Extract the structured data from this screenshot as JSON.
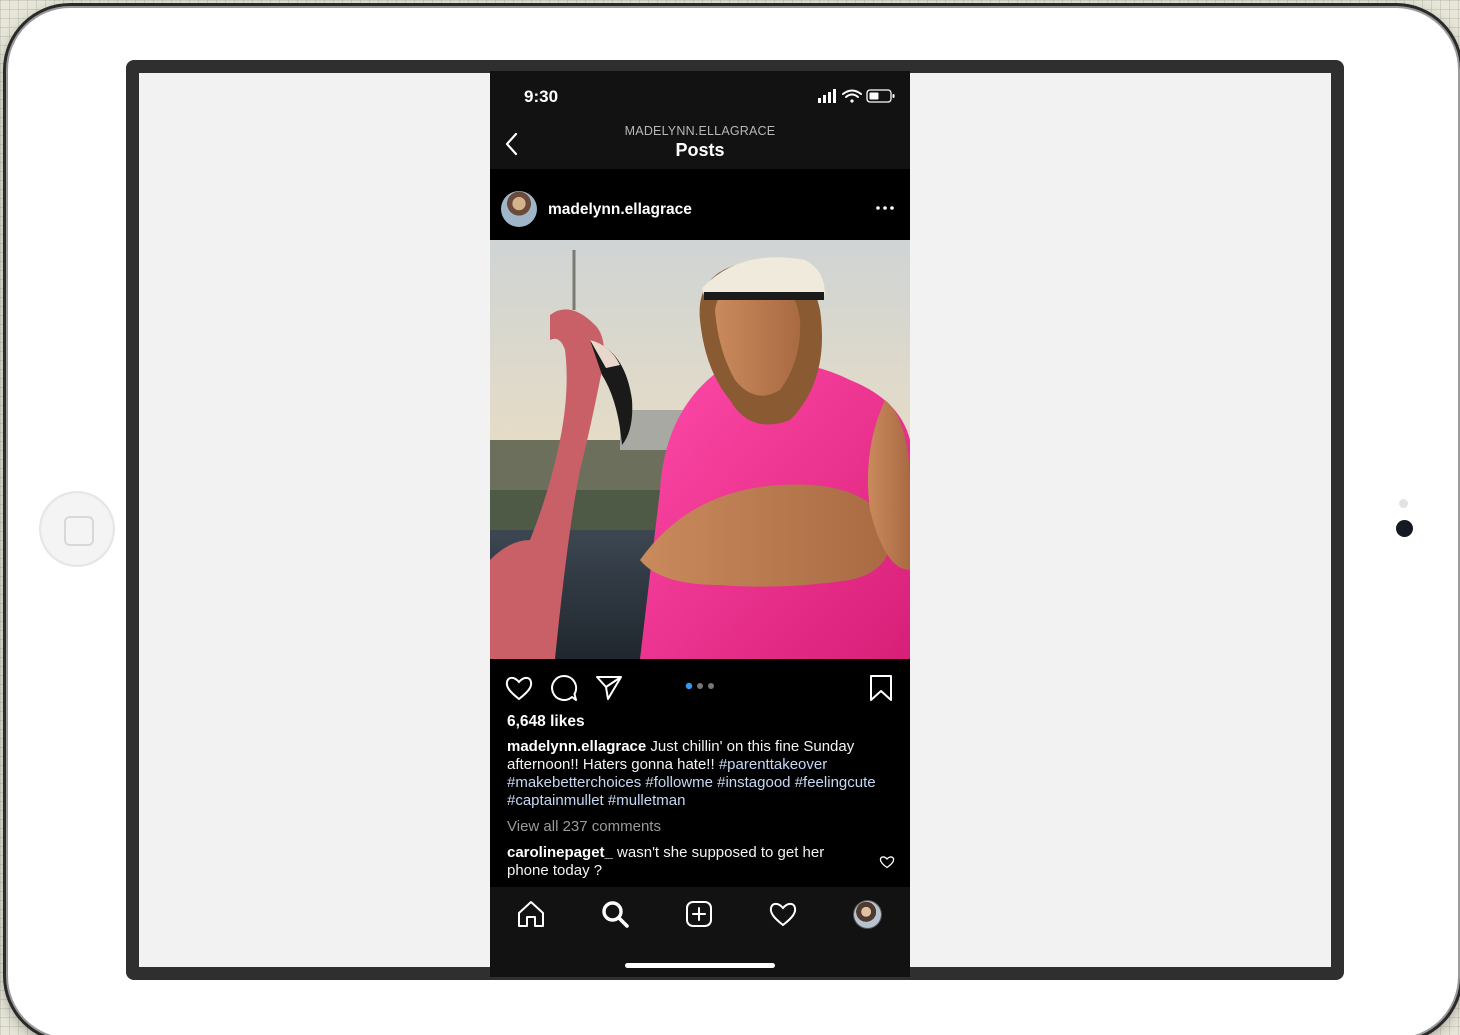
{
  "status_bar": {
    "time": "9:30"
  },
  "nav": {
    "subtitle": "MADELYNN.ELLAGRACE",
    "title": "Posts"
  },
  "post": {
    "username": "madelynn.ellagrace",
    "likes": "6,648 likes",
    "carousel": {
      "count": 3,
      "active": 1,
      "active_color": "#3897f0"
    },
    "caption": {
      "username": "madelynn.ellagrace",
      "text": "Just chillin' on this fine Sunday afternoon!! Haters gonna hate!!",
      "hashtags": [
        "#parenttakeover",
        "#makebetterchoices",
        "#followme",
        "#instagood",
        "#feelingcute",
        "#captainmullet",
        "#mulletman"
      ]
    },
    "view_comments": "View all 237 comments",
    "comment": {
      "username": "carolinepaget_",
      "text": "wasn't she supposed to get her phone today ?"
    }
  },
  "icons": {
    "back": "chevron-left-icon",
    "more": "ellipsis-icon",
    "like": "heart-icon",
    "comment": "speech-bubble-icon",
    "share": "paper-plane-icon",
    "save": "bookmark-icon",
    "tabs": [
      "home-icon",
      "search-icon",
      "add-post-icon",
      "activity-heart-icon",
      "profile-avatar"
    ]
  },
  "colors": {
    "app_background": "#000000",
    "bars_background": "#121212",
    "hashtag": "#c5d9f5",
    "muted_text": "#9a9a9a"
  }
}
